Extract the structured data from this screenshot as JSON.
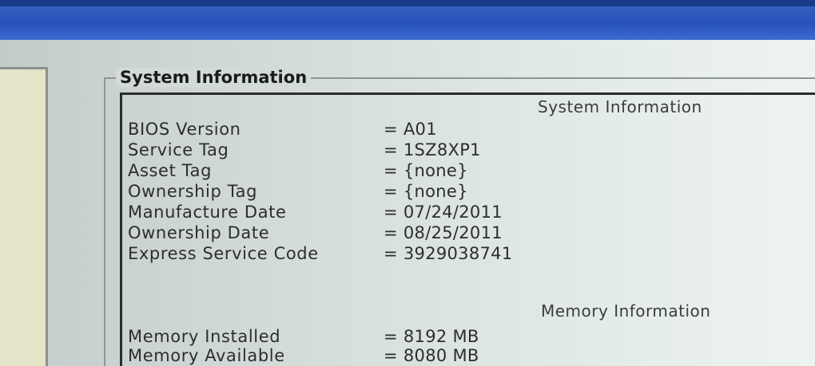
{
  "group": {
    "title": "System Information"
  },
  "system_section": {
    "heading": "System Information",
    "rows": [
      {
        "label": "BIOS Version",
        "value": "= A01"
      },
      {
        "label": "Service Tag",
        "value": "= 1SZ8XP1"
      },
      {
        "label": "Asset Tag",
        "value": "= {none}"
      },
      {
        "label": "Ownership Tag",
        "value": "= {none}"
      },
      {
        "label": "Manufacture Date",
        "value": "= 07/24/2011"
      },
      {
        "label": "Ownership Date",
        "value": "= 08/25/2011"
      },
      {
        "label": "Express Service Code",
        "value": "= 3929038741"
      }
    ]
  },
  "memory_section": {
    "heading": "Memory Information",
    "rows": [
      {
        "label": "Memory Installed",
        "value": "= 8192 MB"
      },
      {
        "label": "Memory Available",
        "value": "= 8080 MB"
      }
    ]
  }
}
